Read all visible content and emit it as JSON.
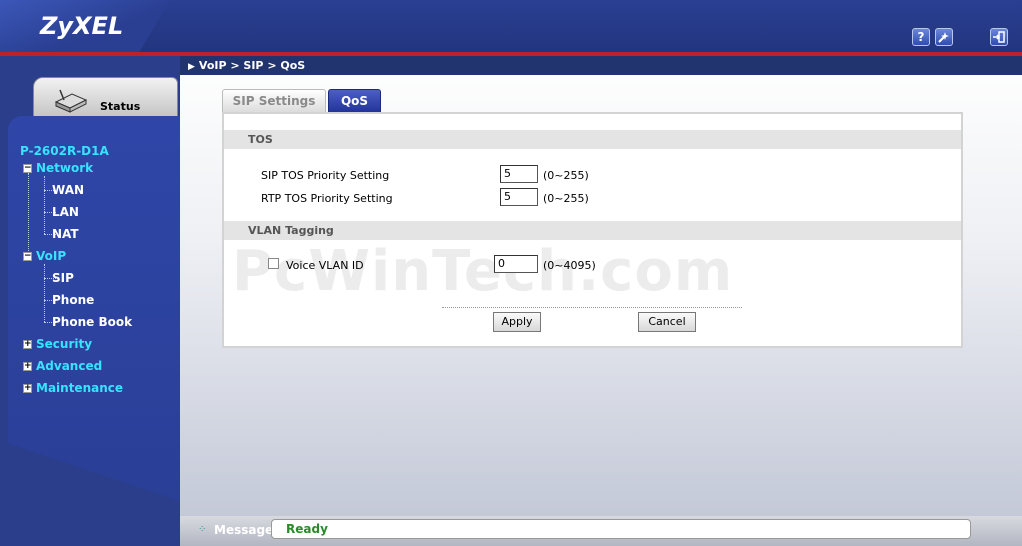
{
  "header": {
    "logo": "ZyXEL",
    "help_icon": "?",
    "wizard_icon": "wizard-icon",
    "logout_icon": "logout-icon"
  },
  "sidebar": {
    "status_label": "Status",
    "device_name": "P-2602R-D1A",
    "groups": [
      {
        "label": "Network",
        "expanded": true,
        "sign": "−",
        "items": [
          "WAN",
          "LAN",
          "NAT"
        ]
      },
      {
        "label": "VoIP",
        "expanded": true,
        "sign": "−",
        "items": [
          "SIP",
          "Phone",
          "Phone Book"
        ]
      },
      {
        "label": "Security",
        "expanded": false,
        "sign": "+"
      },
      {
        "label": "Advanced",
        "expanded": false,
        "sign": "+"
      },
      {
        "label": "Maintenance",
        "expanded": false,
        "sign": "+"
      }
    ]
  },
  "breadcrumb": "VoIP > SIP > QoS",
  "tabs": [
    {
      "label": "SIP Settings",
      "active": false
    },
    {
      "label": "QoS",
      "active": true
    }
  ],
  "form": {
    "tos_title": "TOS",
    "sip_tos_label": "SIP TOS Priority Setting",
    "sip_tos_value": "5",
    "sip_tos_range": "(0~255)",
    "rtp_tos_label": "RTP TOS Priority Setting",
    "rtp_tos_value": "5",
    "rtp_tos_range": "(0~255)",
    "vlan_title": "VLAN Tagging",
    "voice_vlan_label": "Voice VLAN ID",
    "voice_vlan_checked": false,
    "voice_vlan_value": "0",
    "voice_vlan_range": "(0~4095)",
    "apply_label": "Apply",
    "cancel_label": "Cancel"
  },
  "watermark": "PcWinTech.com",
  "statusbar": {
    "message_label": "Message",
    "message_value": "Ready",
    "colors": {
      "ready": "#2a8a2a",
      "accent": "#37e3ff",
      "header_red": "#c0202a"
    }
  }
}
